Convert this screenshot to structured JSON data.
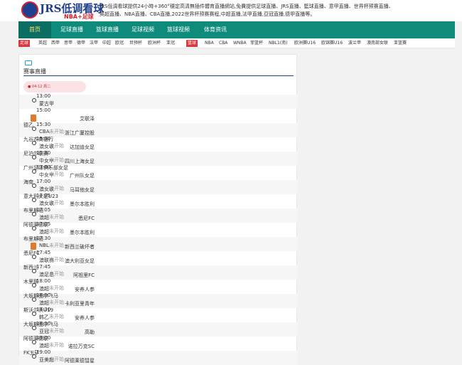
{
  "header": {
    "logo_main": "JRS低调看球",
    "logo_sub": "NBA+足球",
    "description": "JRS低调看球提供24小時+360°穩定高清無插件體育直播網站,免費提供足球直播、JRS直播、籃球直播、意甲直播、世界杯预赛直播、英超直播、NBA直播、CBA直播,2022世界杯预赛赛程,中超直播,法甲直播,亞冠直播,德甲直播等。"
  },
  "nav": {
    "items": [
      "首页",
      "足球直播",
      "篮球直播",
      "足球视频",
      "篮球视频",
      "体育资讯"
    ],
    "active": 0
  },
  "subnav": {
    "football_tag": "足球",
    "football_links": [
      "英超",
      "西甲",
      "意甲",
      "德甲",
      "法甲",
      "中超",
      "欧冠",
      "世预杯",
      "欧洲杯",
      "亚冠"
    ],
    "basketball_tag": "篮球",
    "basketball_links": [
      "NBA",
      "CBA",
      "WNBA",
      "菲篮杯",
      "NBL1(南)",
      "欧洲赛U16",
      "欧锦赛U16",
      "波兰甲",
      "澳南部女联",
      "亚篮赛"
    ]
  },
  "section": {
    "title": "赛事直播",
    "date": "04-12 周二"
  },
  "matches": [
    {
      "time": "13:00",
      "league": "",
      "home": "蒙古甲",
      "away": "",
      "status": ""
    },
    {
      "time": "15:00",
      "league": "德乙",
      "home": "",
      "away": "艾联泽",
      "status": ""
    },
    {
      "time": "15:30",
      "league": "九谷农商银行",
      "home": "CBA",
      "away": "浙江广厦控股",
      "status": "未开始"
    },
    {
      "time": "15:30",
      "league": "尼泊尔联赛",
      "home": "澳女联",
      "away": "达加迪女足",
      "status": "未开始"
    },
    {
      "time": "15:30",
      "league": "广州足球俱乐部女足",
      "home": "中女甲",
      "away": "四川上海女足",
      "status": "未开始"
    },
    {
      "time": "17:00",
      "league": "海南",
      "home": "中女甲",
      "away": "广州队女足",
      "status": "未开始"
    },
    {
      "time": "17:00",
      "league": "意大利女足U23",
      "home": "澳女联",
      "away": "马耳他女足",
      "status": "未开始"
    },
    {
      "time": "17:05",
      "league": "布里斯班",
      "home": "澳女联",
      "away": "墨尔本胜利",
      "status": "未开始"
    },
    {
      "time": "17:05",
      "league": "阿德莱德联",
      "home": "澳超",
      "away": "悉尼FC",
      "status": "未开始"
    },
    {
      "time": "17:05",
      "league": "布里斯班",
      "home": "澳超",
      "away": "墨尔本胜利",
      "status": "未开始"
    },
    {
      "time": "17:30",
      "league": "悉尼FC",
      "home": "NBL",
      "away": "新西兰破坏者",
      "status": "未开始"
    },
    {
      "time": "17:45",
      "league": "新西兰",
      "home": "澳联赛",
      "away": "澳大利亚女足",
      "status": "未开始"
    },
    {
      "time": "17:45",
      "league": "木里联",
      "home": "澳足总",
      "away": "阿祖里FC",
      "status": "未开始"
    },
    {
      "time": "18:00",
      "league": "大坂斯图尔飞马",
      "home": "澳超",
      "away": "安养人参",
      "status": "未开始"
    },
    {
      "time": "18:00",
      "league": "斯沃尔沃U19",
      "home": "澳超",
      "away": "卡利亚里青年",
      "status": "未开始"
    },
    {
      "time": "18:30",
      "league": "大坂斯图尔飞马",
      "home": "韩乙",
      "away": "安养人参",
      "status": "未开始"
    },
    {
      "time": "18:30",
      "league": "阿德莱德联",
      "home": "亚冠",
      "away": "高勒",
      "status": "未开始"
    },
    {
      "time": "19:00",
      "league": "FK五矿",
      "home": "澳超",
      "away": "诺拉万克SC",
      "status": "未开始"
    },
    {
      "time": "19:00",
      "league": "",
      "home": "亚美超",
      "away": "阿德莱德彗星",
      "status": "未开始"
    }
  ]
}
